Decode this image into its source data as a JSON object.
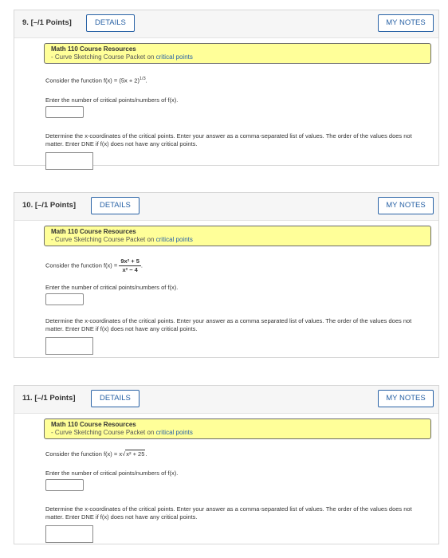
{
  "questions": [
    {
      "number": "9.",
      "points": "[–/1 Points]",
      "details": "DETAILS",
      "notes": "MY NOTES",
      "resource_title": "Math 110 Course Resources",
      "resource_sub": "- Curve Sketching Course Packet on ",
      "resource_link": "critical points",
      "function_intro": "Consider the function ",
      "function_text": "f(x) = (5x + 2)",
      "function_exp": "1/3",
      "function_end": ".",
      "prompt1": "Enter the number of critical points/numbers of f(x).",
      "prompt2": "Determine the x-coordinates of the critical points. Enter your answer as a comma-separated list of values. The order of the values does not matter. Enter DNE if f(x) does not have any critical points."
    },
    {
      "number": "10.",
      "points": "[–/1 Points]",
      "details": "DETAILS",
      "notes": "MY NOTES",
      "resource_title": "Math 110 Course Resources",
      "resource_sub": "- Curve Sketching Course Packet on ",
      "resource_link": "critical points",
      "function_intro": "Consider the function ",
      "function_lhs": "f(x) = ",
      "function_num": "9x² + 5",
      "function_den": "x² − 4",
      "function_end": ".",
      "prompt1": "Enter the number of critical points/numbers of f(x).",
      "prompt2": "Determine the x-coordinates of the critical points. Enter your answer as a comma separated list of values. The order of the values does not matter. Enter DNE if f(x) does not have any critical points."
    },
    {
      "number": "11.",
      "points": "[–/1 Points]",
      "details": "DETAILS",
      "notes": "MY NOTES",
      "resource_title": "Math 110 Course Resources",
      "resource_sub": "- Curve Sketching Course Packet on ",
      "resource_link": "critical points",
      "function_intro": "Consider the function ",
      "function_lhs": "f(x) = x",
      "function_radical": "√",
      "function_radicand": "x² + 25",
      "function_end": ".",
      "prompt1": "Enter the number of critical points/numbers of f(x).",
      "prompt2": "Determine the x-coordinates of the critical points. Enter your answer as a comma-separated list of values. The order of the values does not matter. Enter DNE if f(x) does not have any critical points."
    }
  ],
  "colors": {
    "accent": "#2a63a6",
    "resource_bg": "#ffff99",
    "header_bg": "#f6f6f6"
  }
}
